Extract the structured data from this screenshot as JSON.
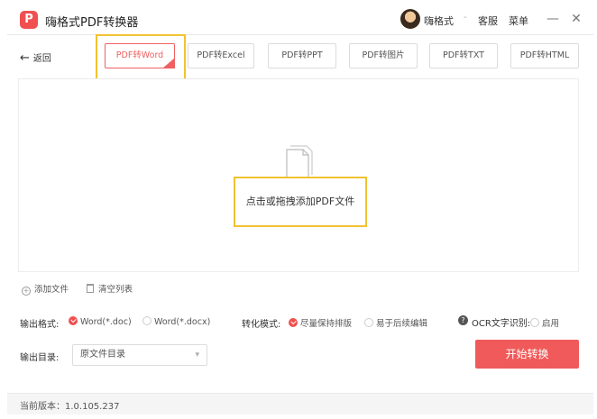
{
  "app": {
    "logo_glyph": "P",
    "title": "嗨格式PDF转换器",
    "username": "嗨格式",
    "separator": "-",
    "service_label": "客服",
    "menu_label": "菜单",
    "minimize_glyph": "—",
    "close_glyph": "✕"
  },
  "nav": {
    "back_glyph": "←",
    "back_label": "返回"
  },
  "tabs": [
    {
      "label": "PDF转Word",
      "active": true
    },
    {
      "label": "PDF转Excel",
      "active": false
    },
    {
      "label": "PDF转PPT",
      "active": false
    },
    {
      "label": "PDF转图片",
      "active": false
    },
    {
      "label": "PDF转TXT",
      "active": false
    },
    {
      "label": "PDF转HTML",
      "active": false
    }
  ],
  "dropzone": {
    "icon": "document-icon",
    "text": "点击或拖拽添加PDF文件"
  },
  "actions": {
    "add_file_glyph": "+",
    "add_file_label": "添加文件",
    "clear_list_label": "清空列表"
  },
  "output_format": {
    "label": "输出格式:",
    "options": [
      {
        "label": "Word(*.doc)",
        "selected": true
      },
      {
        "label": "Word(*.docx)",
        "selected": false
      }
    ]
  },
  "conversion_mode": {
    "label": "转化模式:",
    "options": [
      {
        "label": "尽量保持排版",
        "selected": true
      },
      {
        "label": "易于后续编辑",
        "selected": false
      }
    ]
  },
  "ocr": {
    "help_glyph": "?",
    "label": "OCR文字识别:",
    "option_label": "启用",
    "enabled": false
  },
  "output_dir": {
    "label": "输出目录:",
    "value": "原文件目录",
    "chevron_glyph": "▾"
  },
  "start_button_label": "开始转换",
  "footer": {
    "version": "当前版本：1.0.105.237"
  },
  "colors": {
    "accent": "#f05a5a",
    "highlight": "#f2c230",
    "border": "#dcdcdc"
  }
}
